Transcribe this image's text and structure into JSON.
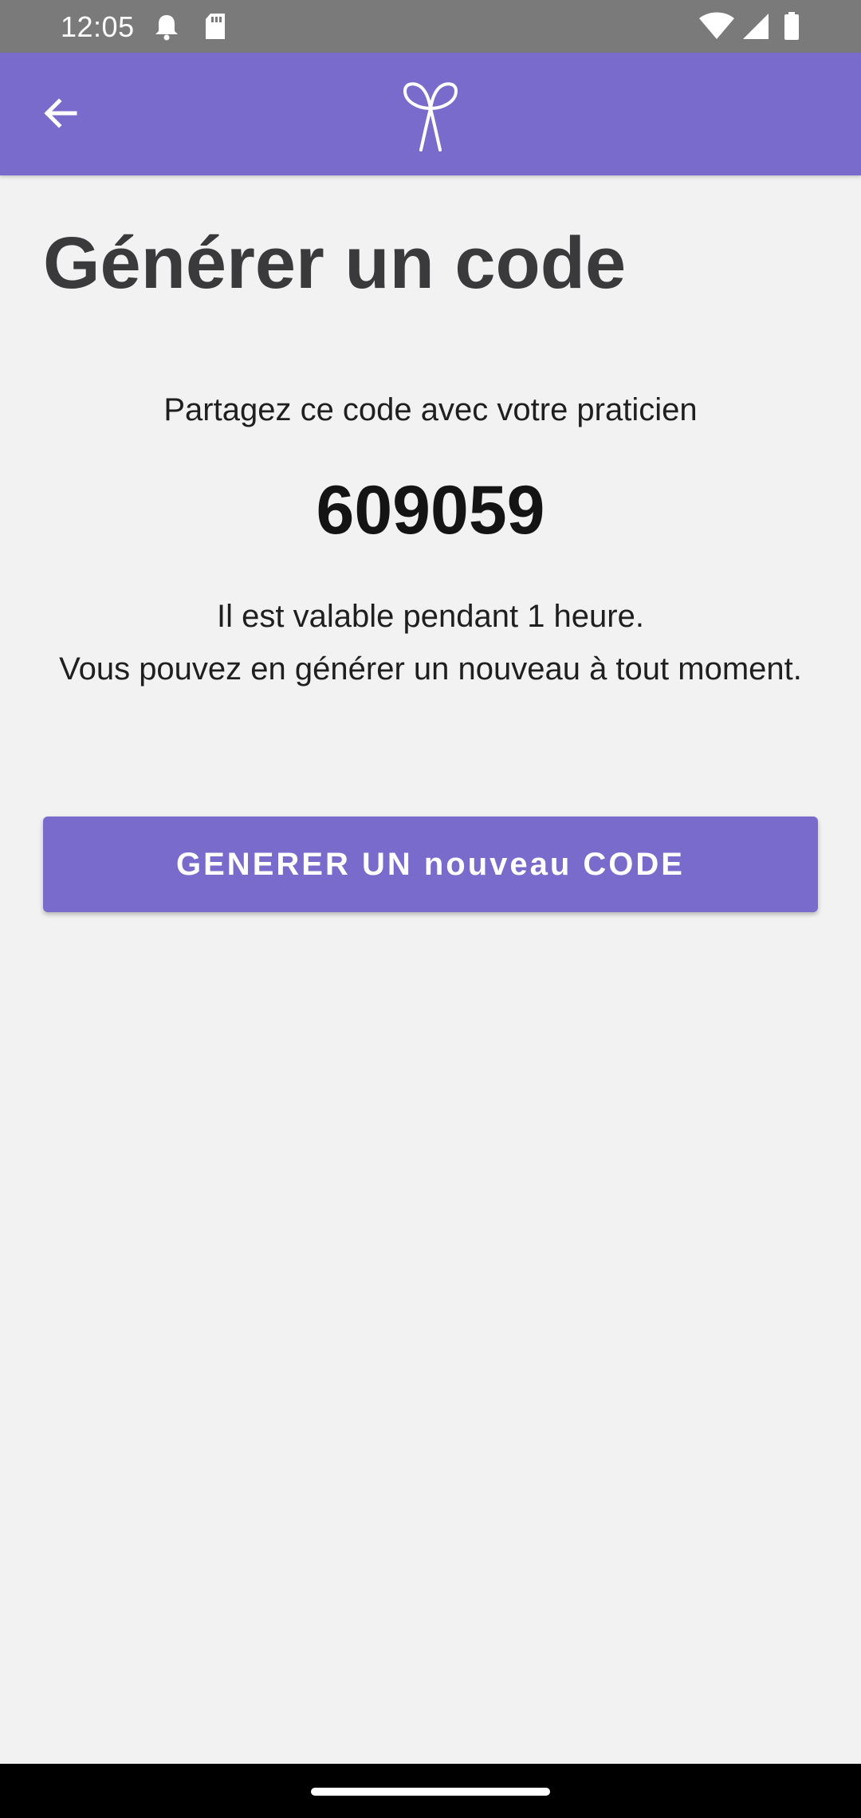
{
  "status_bar": {
    "time": "12:05",
    "icons": [
      "notification-bell-icon",
      "sd-card-icon",
      "wifi-icon",
      "cell-signal-icon",
      "battery-icon"
    ]
  },
  "app_bar": {
    "back_icon": "arrow-left-icon",
    "logo_icon": "ribbon-logo-icon",
    "color": "#786bcb"
  },
  "page": {
    "title": "Générer un code",
    "share_text": "Partagez ce code avec votre praticien",
    "code": "609059",
    "validity_line1": "Il est valable pendant 1 heure.",
    "validity_line2": "Vous pouvez en générer un nouveau à tout moment."
  },
  "actions": {
    "generate_button_label": "GENERER UN nouveau CODE"
  },
  "colors": {
    "accent": "#786bcb",
    "background": "#f2f2f2",
    "title_text": "#3a3a3d",
    "status_bar": "#7a7a7a"
  }
}
